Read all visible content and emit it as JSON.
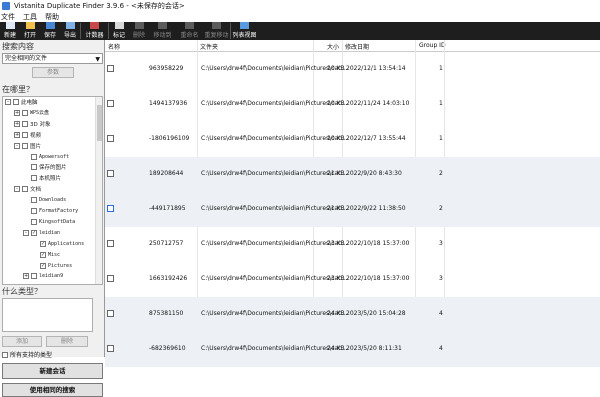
{
  "title": "Vistanita Duplicate Finder 3.9.6 - <未保存的会话>",
  "menu": [
    "文件",
    "工具",
    "帮助"
  ],
  "toolbar": [
    {
      "label": "新建",
      "icon": "new-doc-icon",
      "enabled": true
    },
    {
      "label": "打开",
      "icon": "open-folder-icon",
      "enabled": true
    },
    {
      "label": "保存",
      "icon": "save-icon",
      "enabled": true
    },
    {
      "label": "导出",
      "icon": "export-icon",
      "enabled": true
    },
    {
      "label": "计数器",
      "icon": "counter-icon",
      "enabled": true
    },
    {
      "label": "标记",
      "icon": "mark-icon",
      "enabled": true
    },
    {
      "label": "删除",
      "icon": "delete-icon",
      "enabled": false
    },
    {
      "label": "移动到",
      "icon": "move-icon",
      "enabled": false
    },
    {
      "label": "重命名",
      "icon": "rename-icon",
      "enabled": false
    },
    {
      "label": "重复移动",
      "icon": "repeat-move-icon",
      "enabled": false
    },
    {
      "label": "列表视图",
      "icon": "list-view-icon",
      "enabled": true
    }
  ],
  "left": {
    "search_what": "搜索内容",
    "search_mode": "完全相同的文件",
    "params_button": "参数",
    "where": "在哪里？",
    "tree": [
      {
        "text": "此电脑",
        "level": 0,
        "exp": "-",
        "checked": false
      },
      {
        "text": "WPS云盘",
        "level": 1,
        "exp": "+",
        "checked": false
      },
      {
        "text": "3D 对象",
        "level": 1,
        "exp": "+",
        "checked": false
      },
      {
        "text": "视频",
        "level": 1,
        "exp": "+",
        "checked": false
      },
      {
        "text": "图片",
        "level": 1,
        "exp": "-",
        "checked": false
      },
      {
        "text": "Apowersoft",
        "level": 2,
        "exp": "",
        "checked": false
      },
      {
        "text": "保存的图片",
        "level": 2,
        "exp": "",
        "checked": false
      },
      {
        "text": "本机照片",
        "level": 2,
        "exp": "",
        "checked": false
      },
      {
        "text": "文档",
        "level": 1,
        "exp": "-",
        "checked": false
      },
      {
        "text": "Downloads",
        "level": 2,
        "exp": "",
        "checked": false
      },
      {
        "text": "FormatFactory",
        "level": 2,
        "exp": "",
        "checked": false
      },
      {
        "text": "KingsoftData",
        "level": 2,
        "exp": "",
        "checked": false
      },
      {
        "text": "leidian",
        "level": 2,
        "exp": "-",
        "checked": true
      },
      {
        "text": "Applications",
        "level": 3,
        "exp": "",
        "checked": true
      },
      {
        "text": "Misc",
        "level": 3,
        "exp": "",
        "checked": true
      },
      {
        "text": "Pictures",
        "level": 3,
        "exp": "",
        "checked": true
      },
      {
        "text": "leidian9",
        "level": 2,
        "exp": "+",
        "checked": false
      }
    ],
    "what_type": "什么类型？",
    "add_button": "添加",
    "delete_button": "删除",
    "all_types_label": "所有支持的类型",
    "new_session_button": "新建会话",
    "use_same_search_button": "使用相同的搜索"
  },
  "grid": {
    "headers": [
      "名称",
      "文件夹",
      "大小",
      "修改日期",
      "Group ID"
    ],
    "rows": [
      {
        "name": "963958229",
        "folder": "C:\\Users\\drw4f\\Documents\\leidian\\Pictures\\cac...",
        "size": "10 KB",
        "date": "2022/12/1 13:54:14",
        "group": "1",
        "alt": false
      },
      {
        "name": "1494137936",
        "folder": "C:\\Users\\drw4f\\Documents\\leidian\\Pictures\\cac...",
        "size": "10 KB",
        "date": "2022/11/24 14:03:10",
        "group": "1",
        "alt": false
      },
      {
        "name": "-1806196109",
        "folder": "C:\\Users\\drw4f\\Documents\\leidian\\Pictures\\cac...",
        "size": "10 KB",
        "date": "2022/12/7 13:55:44",
        "group": "1",
        "alt": false
      },
      {
        "name": "189208644",
        "folder": "C:\\Users\\drw4f\\Documents\\leidian\\Pictures\\cac...",
        "size": "21 KB",
        "date": "2022/9/20 8:43:30",
        "group": "2",
        "alt": true
      },
      {
        "name": "-449171895",
        "folder": "C:\\Users\\drw4f\\Documents\\leidian\\Pictures\\cac...",
        "size": "21 KB",
        "date": "2022/9/22 11:38:50",
        "group": "2",
        "alt": true
      },
      {
        "name": "250712757",
        "folder": "C:\\Users\\drw4f\\Documents\\leidian\\Pictures\\cac...",
        "size": "23 KB",
        "date": "2022/10/18 15:37:00",
        "group": "3",
        "alt": false
      },
      {
        "name": "1663192426",
        "folder": "C:\\Users\\drw4f\\Documents\\leidian\\Pictures\\cac...",
        "size": "23 KB",
        "date": "2022/10/18 15:37:00",
        "group": "3",
        "alt": false
      },
      {
        "name": "875381150",
        "folder": "C:\\Users\\drw4f\\Documents\\leidian\\Pictures\\cac...",
        "size": "24 KB",
        "date": "2023/5/20 15:04:28",
        "group": "4",
        "alt": true
      },
      {
        "name": "-682369610",
        "folder": "C:\\Users\\drw4f\\Documents\\leidian\\Pictures\\cac...",
        "size": "24 KB",
        "date": "2023/5/20 8:11:31",
        "group": "4",
        "alt": true
      }
    ]
  },
  "colors": {
    "toolbar_bg": "#1e1e1e",
    "row_alt": "#edf1f5",
    "accent": "#2f6fd6"
  }
}
